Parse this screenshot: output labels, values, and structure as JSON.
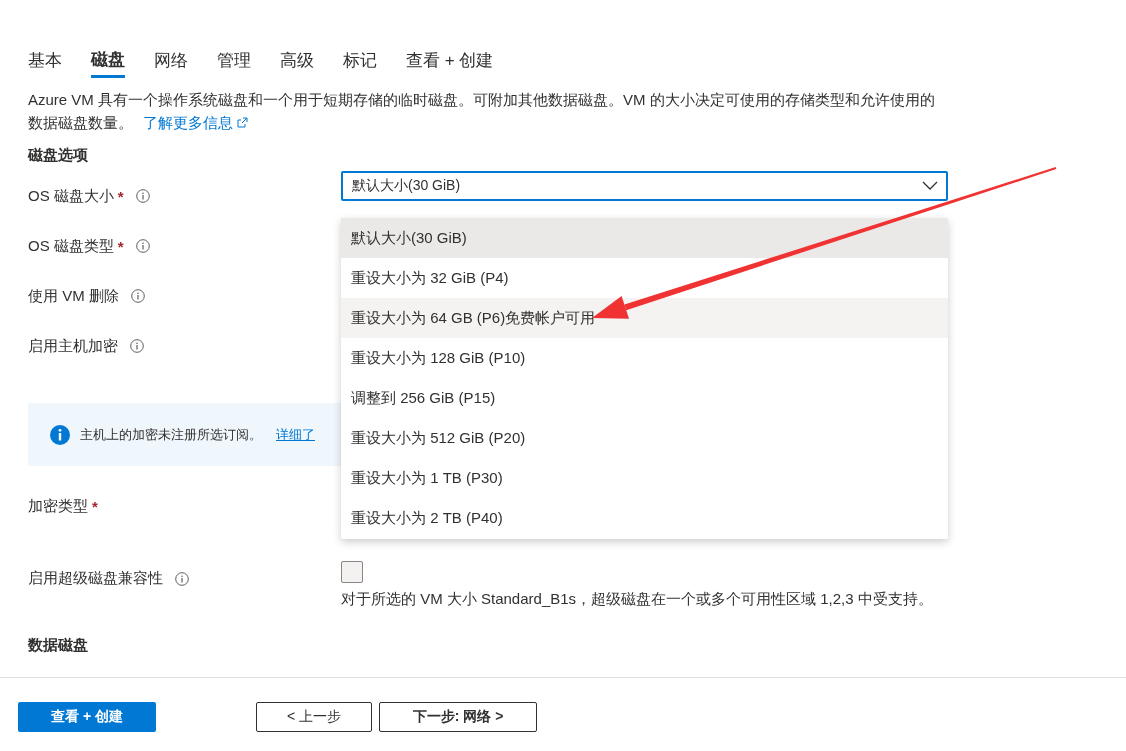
{
  "tabs": [
    {
      "label": "基本",
      "selected": false
    },
    {
      "label": "磁盘",
      "selected": true
    },
    {
      "label": "网络",
      "selected": false
    },
    {
      "label": "管理",
      "selected": false
    },
    {
      "label": "高级",
      "selected": false
    },
    {
      "label": "标记",
      "selected": false
    },
    {
      "label": "查看 + 创建",
      "selected": false
    }
  ],
  "description": {
    "text": "Azure VM 具有一个操作系统磁盘和一个用于短期存储的临时磁盘。可附加其他数据磁盘。VM 的大小决定可使用的存储类型和允许使用的数据磁盘数量。",
    "link": "了解更多信息"
  },
  "disk_options": {
    "heading": "磁盘选项",
    "fields": [
      {
        "label": "OS 磁盘大小",
        "required_mark": "*",
        "info": true,
        "value": "默认大小(30 GiB)"
      },
      {
        "label": "OS 磁盘类型",
        "required_mark": "*",
        "info": true
      },
      {
        "label": "使用 VM 删除",
        "info": true
      },
      {
        "label": "启用主机加密",
        "info": true
      }
    ],
    "banner": {
      "text": "主机上的加密未注册所选订阅。",
      "link": "详细了"
    },
    "encryption_field": {
      "label": "加密类型",
      "required_mark": "*",
      "info": false
    },
    "ultra_disk": {
      "label": "启用超级磁盘兼容性",
      "info": true,
      "checked": false,
      "note": "对于所选的 VM 大小 Standard_B1s，超级磁盘在一个或多个可用性区域 1,2,3 中受支持。"
    }
  },
  "dropdown_options": [
    {
      "label": "默认大小(30 GiB)",
      "selected": true,
      "hovered": false
    },
    {
      "label": "重设大小为 32 GiB (P4)",
      "selected": false,
      "hovered": false
    },
    {
      "label": "重设大小为 64 GB (P6)免费帐户可用",
      "selected": false,
      "hovered": true
    },
    {
      "label": "重设大小为 128 GiB (P10)",
      "selected": false,
      "hovered": false
    },
    {
      "label": "调整到 256 GiB (P15)",
      "selected": false,
      "hovered": false
    },
    {
      "label": "重设大小为 512 GiB (P20)",
      "selected": false,
      "hovered": false
    },
    {
      "label": "重设大小为 1 TB (P30)",
      "selected": false,
      "hovered": false
    },
    {
      "label": "重设大小为 2 TB (P40)",
      "selected": false,
      "hovered": false
    }
  ],
  "data_disks": {
    "heading": "数据磁盘"
  },
  "footer_buttons": [
    {
      "label": "查看 + 创建",
      "kind": "primary"
    },
    {
      "label": "< 上一步",
      "kind": "secondary"
    },
    {
      "label": "下一步: 网络 >",
      "kind": "secondary"
    }
  ]
}
